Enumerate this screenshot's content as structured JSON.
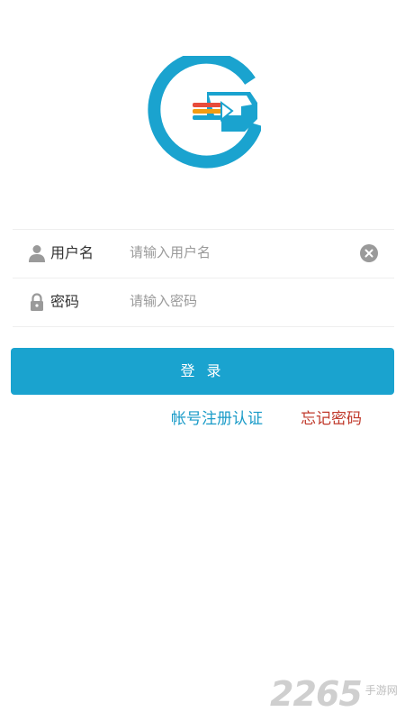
{
  "form": {
    "username": {
      "label": "用户名",
      "placeholder": "请输入用户名",
      "value": ""
    },
    "password": {
      "label": "密码",
      "placeholder": "请输入密码",
      "value": ""
    }
  },
  "actions": {
    "login_label": "登 录",
    "register_label": "帐号注册认证",
    "forgot_label": "忘记密码"
  },
  "watermark": {
    "number": "2265",
    "text": "手游网"
  },
  "colors": {
    "brand_blue": "#1aa3cf",
    "link_blue": "#1a9bc8",
    "link_red": "#c0392b"
  }
}
